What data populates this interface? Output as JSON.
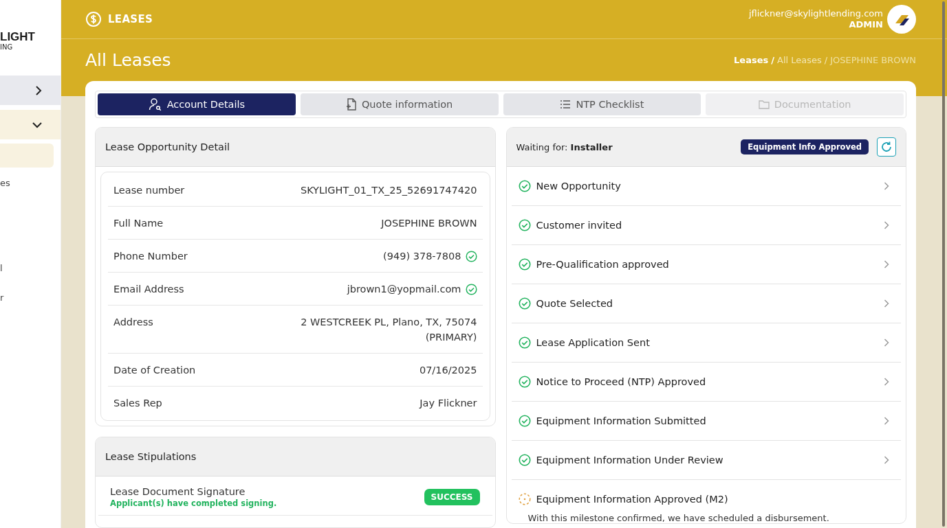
{
  "sidebar": {
    "logo_top": "LIGHT",
    "logo_bottom": "ING",
    "items": [
      {
        "kind": "collapsed"
      },
      {
        "kind": "expanded"
      },
      {
        "kind": "active"
      },
      {
        "label": "es",
        "kind": "link"
      },
      {
        "label": "l",
        "kind": "link"
      },
      {
        "label": "r",
        "kind": "link"
      }
    ]
  },
  "header": {
    "section": "LEASES",
    "user_email": "jflickner@skylightlending.com",
    "user_role": "ADMIN"
  },
  "page": {
    "title": "All Leases",
    "breadcrumb": [
      {
        "label": "Leases",
        "separator": "/",
        "current": false
      },
      {
        "label": "All Leases",
        "separator": "/",
        "current": false
      },
      {
        "label": "JOSEPHINE BROWN",
        "current": true
      }
    ]
  },
  "tabs": [
    {
      "label": "Account Details",
      "selected": true,
      "disabled": false
    },
    {
      "label": "Quote information",
      "selected": false,
      "disabled": false
    },
    {
      "label": "NTP Checklist",
      "selected": false,
      "disabled": false
    },
    {
      "label": "Documentation",
      "selected": false,
      "disabled": true
    }
  ],
  "detail": {
    "title": "Lease Opportunity Detail",
    "rows": [
      {
        "label": "Lease number",
        "value": [
          "SKYLIGHT_01_TX_25_52691747420"
        ],
        "verified": false
      },
      {
        "label": "Full Name",
        "value": [
          "JOSEPHINE BROWN"
        ],
        "verified": false
      },
      {
        "label": "Phone Number",
        "value": [
          "(949) 378-7808"
        ],
        "verified": true
      },
      {
        "label": "Email Address",
        "value": [
          "jbrown1@yopmail.com"
        ],
        "verified": true
      },
      {
        "label": "Address",
        "value": [
          "2 WESTCREEK PL, Plano, TX, 75074",
          "(PRIMARY)"
        ],
        "verified": false
      },
      {
        "label": "Date of Creation",
        "value": [
          "07/16/2025"
        ],
        "verified": false
      },
      {
        "label": "Sales Rep",
        "value": [
          "Jay Flickner"
        ],
        "verified": false
      }
    ]
  },
  "stipulations": {
    "title": "Lease Stipulations",
    "items": [
      {
        "name": "Lease Document Signature",
        "note": "Applicant(s) have completed signing.",
        "status": "SUCCESS"
      }
    ]
  },
  "progress": {
    "waiting_label": "Waiting for:",
    "waiting_for": "Installer",
    "badge": "Equipment Info Approved",
    "steps": [
      {
        "label": "New Opportunity",
        "kind": "done"
      },
      {
        "label": "Customer invited",
        "kind": "done"
      },
      {
        "label": "Pre-Qualification approved",
        "kind": "done"
      },
      {
        "label": "Quote Selected",
        "kind": "done"
      },
      {
        "label": "Lease Application Sent",
        "kind": "done"
      },
      {
        "label": "Notice to Proceed (NTP) Approved",
        "kind": "done"
      },
      {
        "label": "Equipment Information Submitted",
        "kind": "done"
      },
      {
        "label": "Equipment Information Under Review",
        "kind": "done"
      },
      {
        "label": "Equipment Information Approved (M2)",
        "kind": "pending",
        "description": "With this milestone confirmed, we have scheduled a disbursement."
      }
    ]
  }
}
